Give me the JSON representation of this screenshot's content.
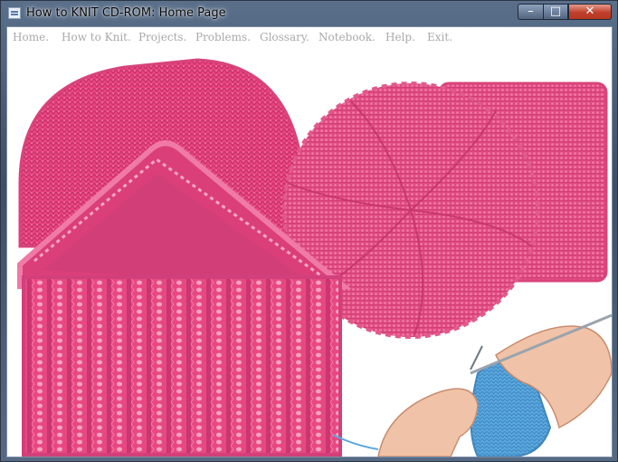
{
  "window": {
    "title": "How to KNIT CD-ROM: Home Page",
    "controls": {
      "minimize": "–",
      "maximize": "□",
      "close": "✕"
    }
  },
  "menu": {
    "items": [
      {
        "label": "Home."
      },
      {
        "label": "How to Knit."
      },
      {
        "label": "Projects."
      },
      {
        "label": "Problems."
      },
      {
        "label": "Glossary."
      },
      {
        "label": "Notebook."
      },
      {
        "label": "Help."
      },
      {
        "label": "Exit."
      }
    ]
  },
  "colors": {
    "knit_pink": "#e8457f",
    "knit_pink_dark": "#c52f67",
    "knit_pink_light": "#f27aa6",
    "knit_blue": "#5aa9e0",
    "skin": "#f0c3a8",
    "menu_text": "#a9a9a9"
  }
}
